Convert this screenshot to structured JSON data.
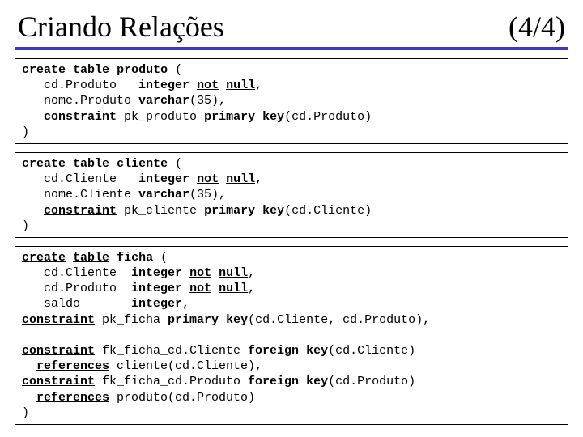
{
  "header": {
    "title": "Criando Relações",
    "page": "(4/4)"
  },
  "box1": {
    "l1a": "create",
    "l1b": "table",
    "l1c": "produto",
    "l1d": " (",
    "l2a": "   cd.Produto   ",
    "l2b": "integer",
    "l2c": " ",
    "l2d": "not",
    "l2e": " ",
    "l2f": "null",
    "l2g": ",",
    "l3a": "   nome.Produto ",
    "l3b": "varchar",
    "l3c": "(35),",
    "l4a": "   ",
    "l4b": "constraint",
    "l4c": " pk_produto ",
    "l4d": "primary",
    "l4e": " ",
    "l4f": "key",
    "l4g": "(cd.Produto)",
    "l5": ")"
  },
  "box2": {
    "l1a": "create",
    "l1b": "table",
    "l1c": "cliente",
    "l1d": " (",
    "l2a": "   cd.Cliente   ",
    "l2b": "integer",
    "l2c": " ",
    "l2d": "not",
    "l2e": " ",
    "l2f": "null",
    "l2g": ",",
    "l3a": "   nome.Cliente ",
    "l3b": "varchar",
    "l3c": "(35),",
    "l4a": "   ",
    "l4b": "constraint",
    "l4c": " pk_cliente ",
    "l4d": "primary",
    "l4e": " ",
    "l4f": "key",
    "l4g": "(cd.Cliente)",
    "l5": ")"
  },
  "box3": {
    "l1a": "create",
    "l1b": "table",
    "l1c": "ficha",
    "l1d": " (",
    "l2a": "   cd.Cliente  ",
    "l2b": "integer",
    "l2c": " ",
    "l2d": "not",
    "l2e": " ",
    "l2f": "null",
    "l2g": ",",
    "l3a": "   cd.Produto  ",
    "l3b": "integer",
    "l3c": " ",
    "l3d": "not",
    "l3e": " ",
    "l3f": "null",
    "l3g": ",",
    "l4a": "   saldo       ",
    "l4b": "integer",
    "l4c": ",",
    "l5a": "constraint",
    "l5b": " pk_ficha ",
    "l5c": "primary",
    "l5d": " ",
    "l5e": "key",
    "l5f": "(cd.Cliente, cd.Produto),",
    "blank": " ",
    "l6a": "constraint",
    "l6b": " fk_ficha_cd.Cliente ",
    "l6c": "foreign",
    "l6d": " ",
    "l6e": "key",
    "l6f": "(cd.Cliente)",
    "l7a": "  ",
    "l7b": "references",
    "l7c": " cliente(cd.Cliente),",
    "l8a": "constraint",
    "l8b": " fk_ficha_cd.Produto ",
    "l8c": "foreign",
    "l8d": " ",
    "l8e": "key",
    "l8f": "(cd.Produto)",
    "l9a": "  ",
    "l9b": "references",
    "l9c": " produto(cd.Produto)",
    "l10": ")"
  }
}
